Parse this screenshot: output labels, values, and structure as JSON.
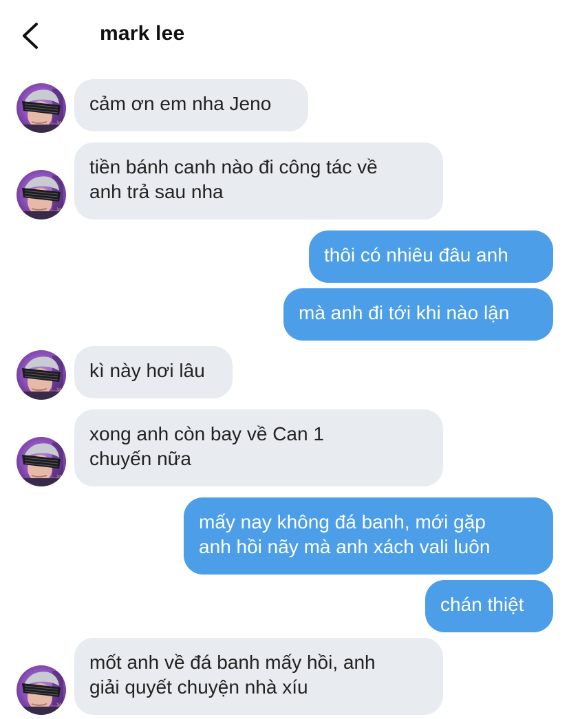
{
  "header": {
    "contact_name": "mark lee",
    "back_icon": "chevron-left-icon"
  },
  "colors": {
    "incoming_bubble": "#e8ebef",
    "outgoing_bubble": "#4b9ee7",
    "incoming_text": "#222222",
    "outgoing_text": "#ffffff"
  },
  "messages": [
    {
      "sender": "them",
      "text": "cảm ơn em nha Jeno"
    },
    {
      "sender": "them",
      "text": "tiền bánh canh nào đi công tác về\nanh trả sau nha"
    },
    {
      "sender": "me",
      "text": "thôi có nhiêu đâu anh"
    },
    {
      "sender": "me",
      "text": "mà anh đi tới khi nào lận"
    },
    {
      "sender": "them",
      "text": "kì này hơi lâu"
    },
    {
      "sender": "them",
      "text": "xong anh còn bay về Can 1\nchuyến nữa"
    },
    {
      "sender": "me",
      "text": "mấy nay không đá banh, mới gặp\nanh hồi nãy mà anh xách vali luôn"
    },
    {
      "sender": "me",
      "text": "chán thiệt"
    },
    {
      "sender": "them",
      "text": "mốt anh về đá banh mấy hồi, anh\ngiải quyết chuyện nhà xíu"
    }
  ]
}
